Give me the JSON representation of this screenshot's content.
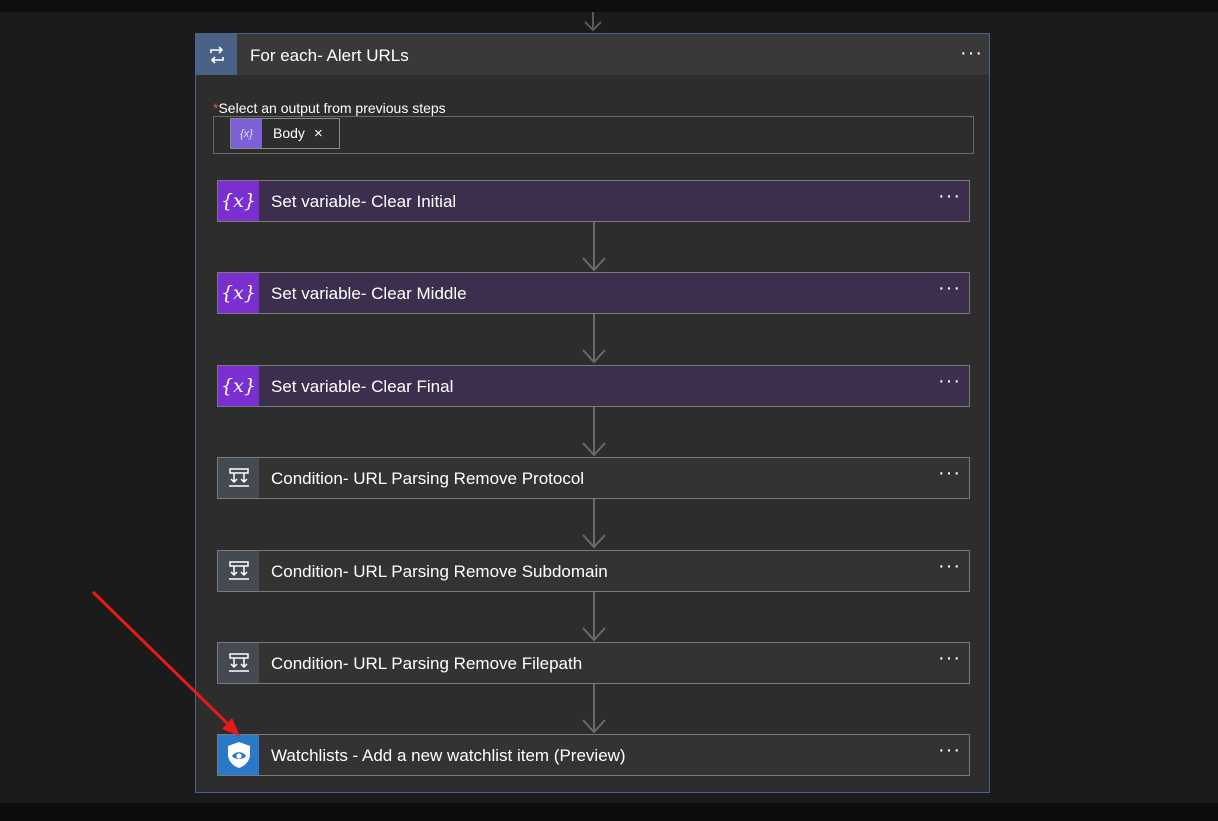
{
  "foreach": {
    "title": "For each- Alert URLs",
    "output_label": "Select an output from previous steps",
    "required_marker": "*",
    "token": {
      "label": "Body",
      "icon": "variable-icon",
      "icon_glyph": "{x}",
      "close": "×"
    },
    "menu": "···"
  },
  "steps": [
    {
      "title": "Set variable- Clear Initial",
      "type": "variable",
      "icon": "variable-icon",
      "menu": "···"
    },
    {
      "title": "Set variable- Clear Middle",
      "type": "variable",
      "icon": "variable-icon",
      "menu": "···"
    },
    {
      "title": "Set variable- Clear Final",
      "type": "variable",
      "icon": "variable-icon",
      "menu": "···"
    },
    {
      "title": "Condition- URL Parsing Remove Protocol",
      "type": "condition",
      "icon": "condition-icon",
      "menu": "···"
    },
    {
      "title": "Condition- URL Parsing Remove Subdomain",
      "type": "condition",
      "icon": "condition-icon",
      "menu": "···"
    },
    {
      "title": "Condition- URL Parsing Remove Filepath",
      "type": "condition",
      "icon": "condition-icon",
      "menu": "···"
    },
    {
      "title": "Watchlists - Add a new watchlist item (Preview)",
      "type": "watchlist",
      "icon": "sentinel-shield-icon",
      "menu": "···"
    }
  ],
  "variable_glyph": "{x}",
  "colors": {
    "variable": "#7b2fd1",
    "condition": "#454a52",
    "watchlist": "#2a78c8",
    "foreach_accent": "#4a6288",
    "annotation_arrow": "#e8191a"
  }
}
